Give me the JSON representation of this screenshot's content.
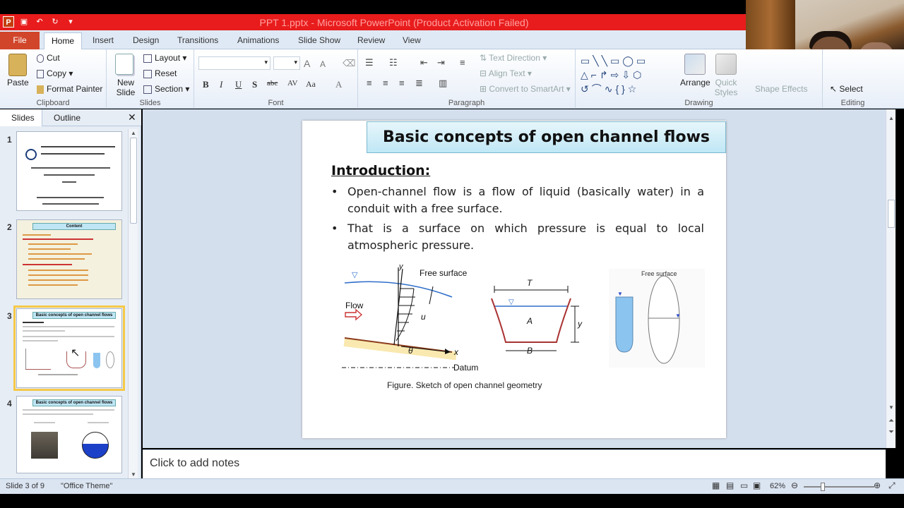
{
  "window": {
    "title": "PPT 1.pptx - Microsoft PowerPoint (Product Activation Failed)"
  },
  "tabs": [
    "Home",
    "Insert",
    "Design",
    "Transitions",
    "Animations",
    "Slide Show",
    "Review",
    "View"
  ],
  "file_tab": "File",
  "ribbon": {
    "clipboard": {
      "paste": "Paste",
      "cut": "Cut",
      "copy": "Copy",
      "format_painter": "Format Painter",
      "label": "Clipboard"
    },
    "slides": {
      "new_slide": "New Slide",
      "layout": "Layout",
      "reset": "Reset",
      "section": "Section",
      "label": "Slides"
    },
    "font": {
      "label": "Font"
    },
    "paragraph": {
      "text_direction": "Text Direction",
      "align_text": "Align Text",
      "convert_smartart": "Convert to SmartArt",
      "label": "Paragraph"
    },
    "drawing": {
      "arrange": "Arrange",
      "quick_styles": "Quick Styles",
      "shape_effects": "Shape Effects",
      "label": "Drawing"
    },
    "editing": {
      "select": "Select",
      "label": "Editing"
    }
  },
  "pane": {
    "slides_tab": "Slides",
    "outline_tab": "Outline"
  },
  "thumbnails": [
    {
      "num": "1"
    },
    {
      "num": "2",
      "title": "Content"
    },
    {
      "num": "3",
      "title": "Basic concepts of open channel flows"
    },
    {
      "num": "4",
      "title": "Basic concepts of open channel flows"
    }
  ],
  "slide": {
    "title": "Basic concepts of open channel flows",
    "intro": "Introduction:",
    "bullets": [
      "Open-channel flow is a flow of liquid (basically water) in a conduit with a free surface.",
      "That is a surface on which pressure is equal to local atmospheric pressure."
    ],
    "figure": {
      "free_surface": "Free surface",
      "flow": "Flow",
      "y": "y",
      "u": "u",
      "theta": "θ",
      "x": "x",
      "datum": "Datum",
      "T": "T",
      "A": "A",
      "B": "B",
      "y2": "y",
      "free_surface2": "Free surface",
      "caption": "Figure. Sketch of open channel geometry"
    }
  },
  "notes": {
    "placeholder": "Click to add notes"
  },
  "status": {
    "slide_info": "Slide 3 of 9",
    "theme": "\"Office Theme\"",
    "zoom": "62%"
  }
}
